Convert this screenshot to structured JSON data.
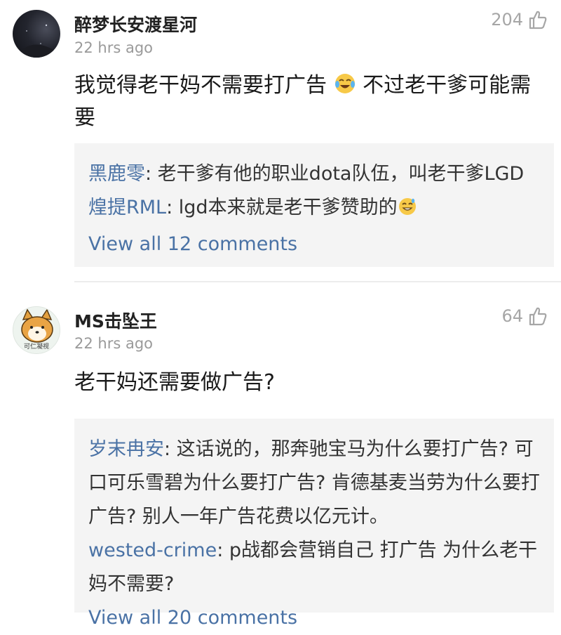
{
  "comments": [
    {
      "username": "醉梦长安渡星河",
      "time": "22 hrs ago",
      "likes": "204",
      "text_a": "我觉得老干妈不需要打广告",
      "text_b": " 不过老干爹可能需要",
      "avatar_icon": "night-sky-avatar",
      "emoji_icon": "laughing-tears-emoji",
      "replies": [
        {
          "name": "黑鹿零",
          "text": ": 老干爹有他的职业dota队伍，叫老干爹LGD"
        },
        {
          "name": "煌提RML",
          "text": ": lgd本来就是老干爹赞助的",
          "emoji_icon": "grinning-sweat-emoji"
        }
      ],
      "view_all": "View all 12 comments"
    },
    {
      "username": "MS击坠王",
      "time": "22 hrs ago",
      "likes": "64",
      "text": "老干妈还需要做广告?",
      "avatar_icon": "shiba-dog-avatar",
      "avatar_caption": "可仁凝视",
      "replies": [
        {
          "name": "岁末冉安",
          "text": ": 这话说的，那奔驰宝马为什么要打广告? 可口可乐雪碧为什么要打广告? 肯德基麦当劳为什么要打广告? 别人一年广告花费以亿元计。"
        },
        {
          "name": "wested-crime",
          "text": ": p战都会营销自己 打广告 为什么老干妈不需要?"
        }
      ],
      "view_all": "View all 20 comments"
    }
  ],
  "icons": {
    "like": "thumbs-up-icon"
  },
  "colors": {
    "link_blue": "#4a72a5",
    "meta_gray": "#9a9a9a",
    "reply_bg": "#f4f4f4"
  }
}
